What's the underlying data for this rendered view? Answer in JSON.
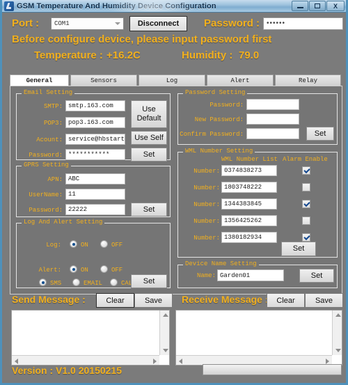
{
  "window": {
    "title": "GSM Temperature And Humidity Device Configuration",
    "icon": "app-icon",
    "controls": {
      "minimize": "–",
      "maximize": "□",
      "close": "X"
    }
  },
  "top": {
    "port_label": "Port :",
    "port_value": "COM1",
    "disconnect_label": "Disconnect",
    "password_label": "Password :",
    "password_value": "••••••",
    "notice": "Before configure device, please input password first",
    "temperature_label": "Temperature :",
    "temperature_value": "+16.2C",
    "humidity_label": "Humidity :",
    "humidity_value": "79.0"
  },
  "tabs": [
    {
      "label": "General",
      "active": true
    },
    {
      "label": "Sensors",
      "active": false
    },
    {
      "label": "Log",
      "active": false
    },
    {
      "label": "Alert",
      "active": false
    },
    {
      "label": "Relay",
      "active": false
    }
  ],
  "email_setting": {
    "legend": "Email Setting",
    "smtp_label": "SMTP:",
    "smtp_value": "smtp.163.com",
    "pop3_label": "POP3:",
    "pop3_value": "pop3.163.com",
    "account_label": "Acount:",
    "account_value": "service@hbstart.c",
    "password_label": "Password:",
    "password_value": "***********",
    "use_default_label": "Use\nDefault",
    "use_default_line1": "Use",
    "use_default_line2": "Default",
    "use_self_label": "Use Self",
    "set_label": "Set"
  },
  "gprs_setting": {
    "legend": "GPRS Setting",
    "apn_label": "APN:",
    "apn_value": "ABC",
    "username_label": "UserName:",
    "username_value": "11",
    "password_label": "Password:",
    "password_value": "22222",
    "set_label": "Set"
  },
  "log_alert_setting": {
    "legend": "Log And Alert Setting",
    "log_label": "Log:",
    "log_on": "ON",
    "log_off": "OFF",
    "log_selected": "ON",
    "alert_label": "Alert:",
    "alert_on": "ON",
    "alert_off": "OFF",
    "alert_selected": "ON",
    "method_sms": "SMS",
    "method_email": "EMAIL",
    "method_call": "CALL",
    "method_selected": "SMS",
    "set_label": "Set"
  },
  "password_setting": {
    "legend": "Password Setting",
    "password_label": "Password:",
    "password_value": "",
    "new_password_label": "New Password:",
    "new_password_value": "",
    "confirm_password_label": "Confirm Password:",
    "confirm_password_value": "",
    "set_label": "Set"
  },
  "wml_number_setting": {
    "legend": "WML Number Setting",
    "list_header": "WML Number List",
    "alarm_header": "Alarm Enable",
    "rows": [
      {
        "label": "Number:",
        "value": "0374838273",
        "enabled": true
      },
      {
        "label": "Number:",
        "value": "1803748222",
        "enabled": false
      },
      {
        "label": "Number:",
        "value": "1344383845",
        "enabled": true
      },
      {
        "label": "Number:",
        "value": "1356425262",
        "enabled": false
      },
      {
        "label": "Number:",
        "value": "1380182934",
        "enabled": true
      }
    ],
    "set_label": "Set"
  },
  "device_name_setting": {
    "legend": "Device Name Setting",
    "name_label": "Name:",
    "name_value": "Garden01",
    "set_label": "Set"
  },
  "send_message": {
    "title": "Send Message :",
    "clear_label": "Clear",
    "save_label": "Save",
    "text": ""
  },
  "receive_message": {
    "title": "Receive Message :",
    "clear_label": "Clear",
    "save_label": "Save",
    "text": ""
  },
  "footer": {
    "version": "Version : V1.0 20150215",
    "progress_percent": 0
  },
  "colors": {
    "accent_yellow": "#f2b01e",
    "window_bg": "#7b7b7b",
    "panel_bg": "#757575",
    "frame_blue": "#4e91bb"
  }
}
